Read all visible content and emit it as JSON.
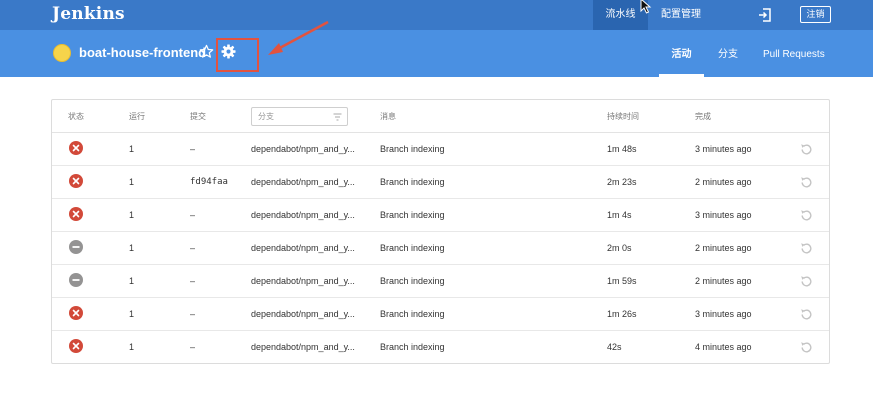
{
  "topbar": {
    "brand": "Jenkins",
    "pipeline_label": "流水线",
    "manage_label": "配置管理",
    "logout_label": "注销"
  },
  "subheader": {
    "job_name": "boat-house-frontend",
    "tabs": {
      "activity": "活动",
      "branches": "分支",
      "pull_requests": "Pull Requests"
    }
  },
  "table": {
    "headers": {
      "status": "状态",
      "run": "运行",
      "commit": "提交",
      "branch_placeholder": "分支",
      "message": "消息",
      "duration": "持续时间",
      "completed": "完成"
    },
    "rows": [
      {
        "status": "failed",
        "run": "1",
        "commit": "–",
        "branch": "dependabot/npm_and_y...",
        "message": "Branch indexing",
        "duration": "1m 48s",
        "completed": "3 minutes ago"
      },
      {
        "status": "failed",
        "run": "1",
        "commit": "fd94faa",
        "branch": "dependabot/npm_and_y...",
        "message": "Branch indexing",
        "duration": "2m 23s",
        "completed": "2 minutes ago"
      },
      {
        "status": "failed",
        "run": "1",
        "commit": "–",
        "branch": "dependabot/npm_and_y...",
        "message": "Branch indexing",
        "duration": "1m 4s",
        "completed": "3 minutes ago"
      },
      {
        "status": "aborted",
        "run": "1",
        "commit": "–",
        "branch": "dependabot/npm_and_y...",
        "message": "Branch indexing",
        "duration": "2m 0s",
        "completed": "2 minutes ago"
      },
      {
        "status": "aborted",
        "run": "1",
        "commit": "–",
        "branch": "dependabot/npm_and_y...",
        "message": "Branch indexing",
        "duration": "1m 59s",
        "completed": "2 minutes ago"
      },
      {
        "status": "failed",
        "run": "1",
        "commit": "–",
        "branch": "dependabot/npm_and_y...",
        "message": "Branch indexing",
        "duration": "1m 26s",
        "completed": "3 minutes ago"
      },
      {
        "status": "failed",
        "run": "1",
        "commit": "–",
        "branch": "dependabot/npm_and_y...",
        "message": "Branch indexing",
        "duration": "42s",
        "completed": "4 minutes ago"
      }
    ]
  },
  "icons": {
    "weather": "sunny-weather-icon",
    "favorite": "star-icon",
    "settings": "gear-icon",
    "exit": "exit-icon",
    "failed": "failed-status-icon",
    "aborted": "aborted-status-icon",
    "replay": "replay-icon",
    "filter": "filter-icon"
  },
  "colors": {
    "topbar": "#3a79c8",
    "subheader": "#4a90e2",
    "failed": "#d24939",
    "aborted": "#949393",
    "annotation": "#e2533f",
    "weather": "#f6d44b"
  }
}
